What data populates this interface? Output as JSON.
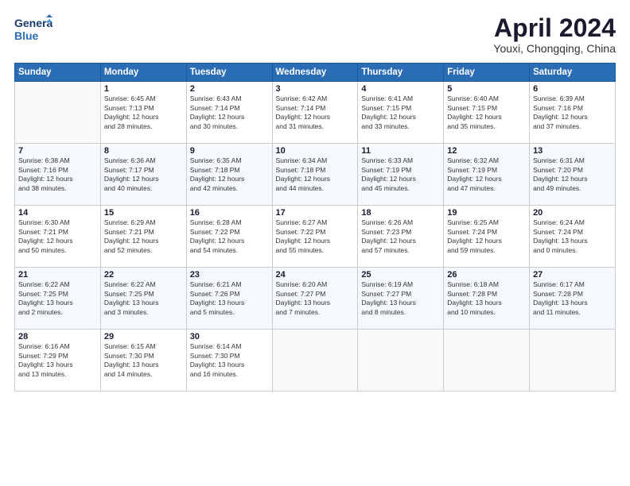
{
  "logo": {
    "line1": "General",
    "line2": "Blue"
  },
  "title": "April 2024",
  "subtitle": "Youxi, Chongqing, China",
  "header_days": [
    "Sunday",
    "Monday",
    "Tuesday",
    "Wednesday",
    "Thursday",
    "Friday",
    "Saturday"
  ],
  "weeks": [
    [
      {
        "day": "",
        "info": ""
      },
      {
        "day": "1",
        "info": "Sunrise: 6:45 AM\nSunset: 7:13 PM\nDaylight: 12 hours\nand 28 minutes."
      },
      {
        "day": "2",
        "info": "Sunrise: 6:43 AM\nSunset: 7:14 PM\nDaylight: 12 hours\nand 30 minutes."
      },
      {
        "day": "3",
        "info": "Sunrise: 6:42 AM\nSunset: 7:14 PM\nDaylight: 12 hours\nand 31 minutes."
      },
      {
        "day": "4",
        "info": "Sunrise: 6:41 AM\nSunset: 7:15 PM\nDaylight: 12 hours\nand 33 minutes."
      },
      {
        "day": "5",
        "info": "Sunrise: 6:40 AM\nSunset: 7:15 PM\nDaylight: 12 hours\nand 35 minutes."
      },
      {
        "day": "6",
        "info": "Sunrise: 6:39 AM\nSunset: 7:16 PM\nDaylight: 12 hours\nand 37 minutes."
      }
    ],
    [
      {
        "day": "7",
        "info": "Sunrise: 6:38 AM\nSunset: 7:16 PM\nDaylight: 12 hours\nand 38 minutes."
      },
      {
        "day": "8",
        "info": "Sunrise: 6:36 AM\nSunset: 7:17 PM\nDaylight: 12 hours\nand 40 minutes."
      },
      {
        "day": "9",
        "info": "Sunrise: 6:35 AM\nSunset: 7:18 PM\nDaylight: 12 hours\nand 42 minutes."
      },
      {
        "day": "10",
        "info": "Sunrise: 6:34 AM\nSunset: 7:18 PM\nDaylight: 12 hours\nand 44 minutes."
      },
      {
        "day": "11",
        "info": "Sunrise: 6:33 AM\nSunset: 7:19 PM\nDaylight: 12 hours\nand 45 minutes."
      },
      {
        "day": "12",
        "info": "Sunrise: 6:32 AM\nSunset: 7:19 PM\nDaylight: 12 hours\nand 47 minutes."
      },
      {
        "day": "13",
        "info": "Sunrise: 6:31 AM\nSunset: 7:20 PM\nDaylight: 12 hours\nand 49 minutes."
      }
    ],
    [
      {
        "day": "14",
        "info": "Sunrise: 6:30 AM\nSunset: 7:21 PM\nDaylight: 12 hours\nand 50 minutes."
      },
      {
        "day": "15",
        "info": "Sunrise: 6:29 AM\nSunset: 7:21 PM\nDaylight: 12 hours\nand 52 minutes."
      },
      {
        "day": "16",
        "info": "Sunrise: 6:28 AM\nSunset: 7:22 PM\nDaylight: 12 hours\nand 54 minutes."
      },
      {
        "day": "17",
        "info": "Sunrise: 6:27 AM\nSunset: 7:22 PM\nDaylight: 12 hours\nand 55 minutes."
      },
      {
        "day": "18",
        "info": "Sunrise: 6:26 AM\nSunset: 7:23 PM\nDaylight: 12 hours\nand 57 minutes."
      },
      {
        "day": "19",
        "info": "Sunrise: 6:25 AM\nSunset: 7:24 PM\nDaylight: 12 hours\nand 59 minutes."
      },
      {
        "day": "20",
        "info": "Sunrise: 6:24 AM\nSunset: 7:24 PM\nDaylight: 13 hours\nand 0 minutes."
      }
    ],
    [
      {
        "day": "21",
        "info": "Sunrise: 6:22 AM\nSunset: 7:25 PM\nDaylight: 13 hours\nand 2 minutes."
      },
      {
        "day": "22",
        "info": "Sunrise: 6:22 AM\nSunset: 7:25 PM\nDaylight: 13 hours\nand 3 minutes."
      },
      {
        "day": "23",
        "info": "Sunrise: 6:21 AM\nSunset: 7:26 PM\nDaylight: 13 hours\nand 5 minutes."
      },
      {
        "day": "24",
        "info": "Sunrise: 6:20 AM\nSunset: 7:27 PM\nDaylight: 13 hours\nand 7 minutes."
      },
      {
        "day": "25",
        "info": "Sunrise: 6:19 AM\nSunset: 7:27 PM\nDaylight: 13 hours\nand 8 minutes."
      },
      {
        "day": "26",
        "info": "Sunrise: 6:18 AM\nSunset: 7:28 PM\nDaylight: 13 hours\nand 10 minutes."
      },
      {
        "day": "27",
        "info": "Sunrise: 6:17 AM\nSunset: 7:28 PM\nDaylight: 13 hours\nand 11 minutes."
      }
    ],
    [
      {
        "day": "28",
        "info": "Sunrise: 6:16 AM\nSunset: 7:29 PM\nDaylight: 13 hours\nand 13 minutes."
      },
      {
        "day": "29",
        "info": "Sunrise: 6:15 AM\nSunset: 7:30 PM\nDaylight: 13 hours\nand 14 minutes."
      },
      {
        "day": "30",
        "info": "Sunrise: 6:14 AM\nSunset: 7:30 PM\nDaylight: 13 hours\nand 16 minutes."
      },
      {
        "day": "",
        "info": ""
      },
      {
        "day": "",
        "info": ""
      },
      {
        "day": "",
        "info": ""
      },
      {
        "day": "",
        "info": ""
      }
    ]
  ]
}
